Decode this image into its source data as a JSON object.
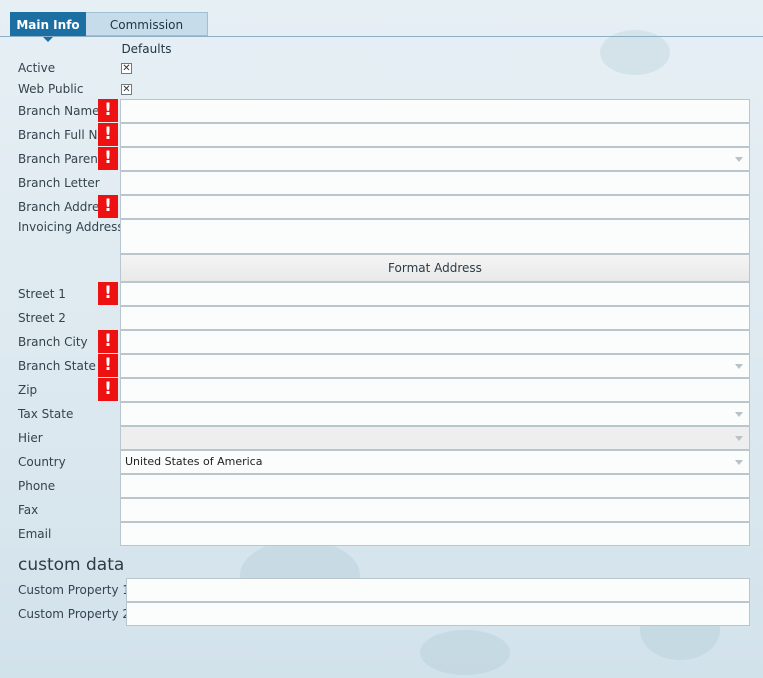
{
  "tabs": [
    {
      "label": "Main Info",
      "active": true
    },
    {
      "label": "Commission Defaults",
      "active": false
    }
  ],
  "form": {
    "active_label": "Active",
    "active_checked": true,
    "web_public_label": "Web Public",
    "web_public_checked": true,
    "checkbox_glyph": "✕",
    "required_glyph": "!",
    "branch_name_label": "Branch Name",
    "branch_full_name_label": "Branch Full Name",
    "branch_parent_label": "Branch Parent",
    "branch_letter_label": "Branch Letter",
    "branch_address_label": "Branch Address",
    "invoicing_address_label": "Invoicing Address",
    "format_address_button": "Format Address",
    "street1_label": "Street 1",
    "street2_label": "Street 2",
    "branch_city_label": "Branch City",
    "branch_state_label": "Branch State",
    "zip_label": "Zip",
    "tax_state_label": "Tax State",
    "hier_label": "Hier",
    "country_label": "Country",
    "country_value": "United States of America",
    "phone_label": "Phone",
    "fax_label": "Fax",
    "email_label": "Email"
  },
  "custom": {
    "title": "custom data",
    "property1_label": "Custom Property 1",
    "property2_label": "Custom Property 2"
  },
  "colors": {
    "accent": "#1b6fa3",
    "required": "#ee1111"
  }
}
